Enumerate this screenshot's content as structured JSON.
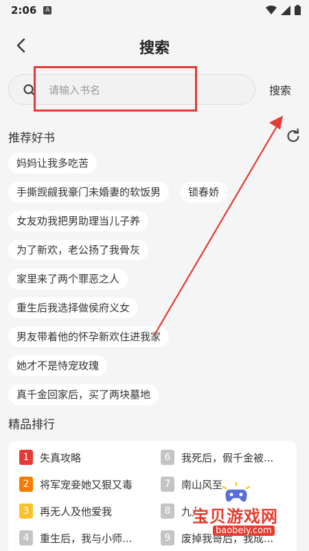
{
  "status_bar": {
    "time": "2:06",
    "badge": "A"
  },
  "header": {
    "title": "搜索"
  },
  "search": {
    "placeholder": "请输入书名",
    "value": "",
    "button_label": "搜索"
  },
  "recommended": {
    "title": "推荐好书",
    "rows": [
      [
        "妈妈让我多吃苦"
      ],
      [
        "手撕觊觎我豪门未婚妻的软饭男",
        "锁春娇"
      ],
      [
        "女友劝我把男助理当儿子养"
      ],
      [
        "为了新欢，老公扬了我骨灰"
      ],
      [
        "家里来了两个罪恶之人"
      ],
      [
        "重生后我选择做侯府义女"
      ],
      [
        "男友带着他的怀孕新欢住进我家"
      ],
      [
        "她才不是恃宠玫瑰"
      ],
      [
        "真千金回家后，买了两块墓地"
      ]
    ]
  },
  "ranking": {
    "title": "精品排行",
    "items": [
      {
        "num": "1",
        "title": "失真攻略",
        "color": "#e53935"
      },
      {
        "num": "6",
        "title": "我死后，假千金被...",
        "color": "#c4c4c4"
      },
      {
        "num": "2",
        "title": "将军宠妾她又狠又毒",
        "color": "#f57c00"
      },
      {
        "num": "7",
        "title": "南山风至",
        "color": "#c4c4c4"
      },
      {
        "num": "3",
        "title": "再无人及他爱我",
        "color": "#fbc02d"
      },
      {
        "num": "8",
        "title": "九九",
        "color": "#c4c4c4"
      },
      {
        "num": "4",
        "title": "重生后，我与小师...",
        "color": "#c4c4c4"
      },
      {
        "num": "9",
        "title": "废掉我哥后，我成...",
        "color": "#c4c4c4"
      }
    ]
  },
  "watermark": {
    "text": "宝贝游戏网",
    "url": "baobeiy.com"
  },
  "colors": {
    "annotation": "#e53935",
    "background": "#f5f5f5"
  }
}
